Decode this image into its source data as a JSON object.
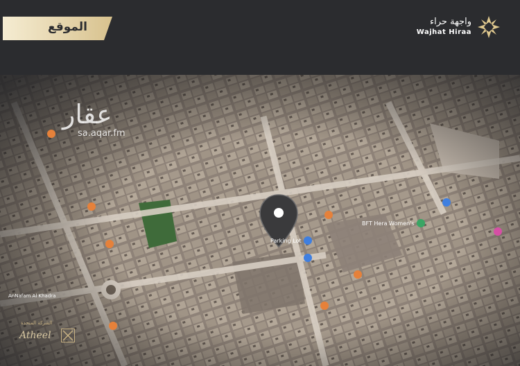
{
  "header": {
    "section_title": "الموقع",
    "brand_ar": "واجهة حراء",
    "brand_en": "Wajhat Hiraa"
  },
  "watermark": {
    "text_ar": "عقار",
    "url": "sa.aqar.fm"
  },
  "map_labels": {
    "parking": "Parking Lot",
    "bft": "BFT Hera Women's",
    "roundabout": "AnNafam Al Khadra"
  },
  "developer": {
    "name_ar": "الشركة المتحدة",
    "name_en": "Atheel"
  },
  "colors": {
    "gold": "#e6d3a3",
    "pin": "#3a3a3c",
    "poi_orange": "#e6813a",
    "poi_blue": "#3f7fe0",
    "poi_green": "#3aa564",
    "poi_pink": "#d64fa5"
  }
}
